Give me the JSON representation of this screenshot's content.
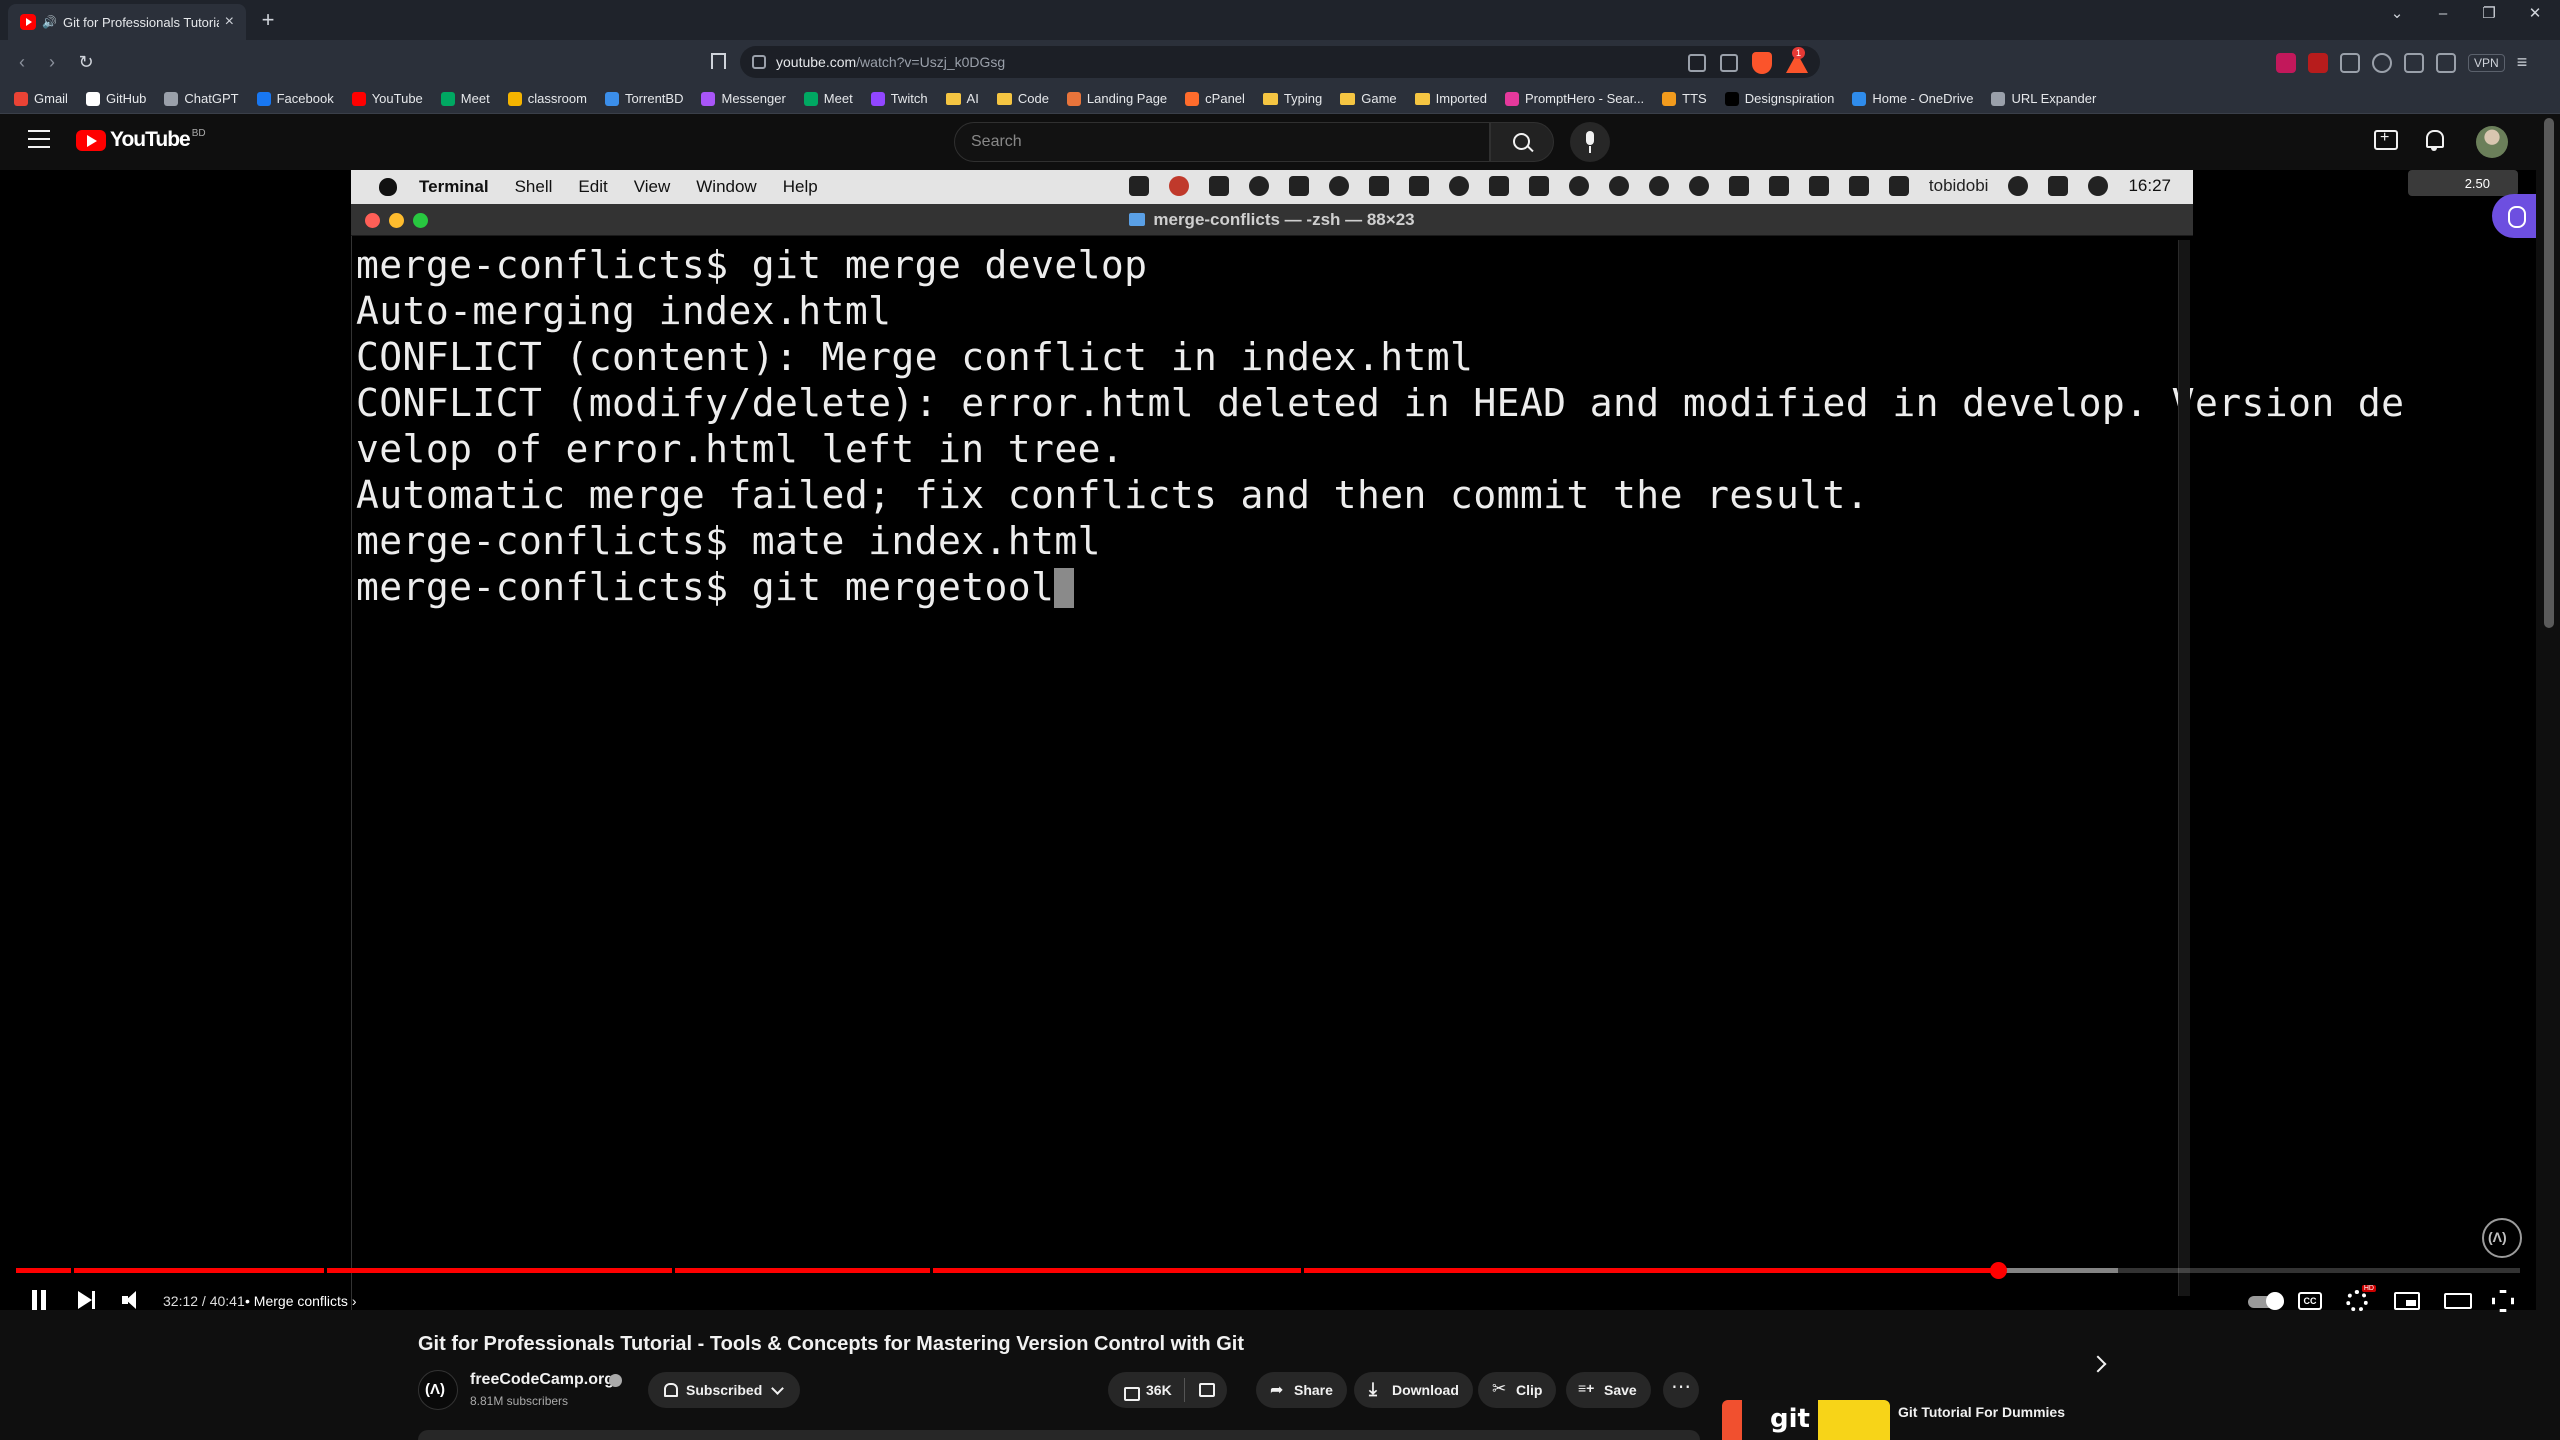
{
  "browser": {
    "tab_title": "Git for Professionals Tutorial",
    "new_tab": "+",
    "url_host": "youtube.com",
    "url_path": "/watch?v=Uszj_k0DGsg",
    "vpn_label": "VPN",
    "rewards_badge": "1",
    "bookmarks": [
      {
        "label": "Gmail",
        "icon": "gmail-icon",
        "color": "#ea4335"
      },
      {
        "label": "GitHub",
        "icon": "github-icon",
        "color": "#ffffff"
      },
      {
        "label": "ChatGPT",
        "icon": "chatgpt-icon",
        "color": "#9aa0aa"
      },
      {
        "label": "Facebook",
        "icon": "facebook-icon",
        "color": "#1877f2"
      },
      {
        "label": "YouTube",
        "icon": "youtube-icon",
        "color": "#ff0000"
      },
      {
        "label": "Meet",
        "icon": "meet-icon",
        "color": "#00a862"
      },
      {
        "label": "classroom",
        "icon": "classroom-icon",
        "color": "#f5b400"
      },
      {
        "label": "TorrentBD",
        "icon": "torrentbd-icon",
        "color": "#3b8eea"
      },
      {
        "label": "Messenger",
        "icon": "messenger-icon",
        "color": "#a855f7"
      },
      {
        "label": "Meet",
        "icon": "meet-icon",
        "color": "#00a862"
      },
      {
        "label": "Twitch",
        "icon": "twitch-icon",
        "color": "#9146ff"
      },
      {
        "label": "AI",
        "icon": "folder-icon",
        "color": "#f5c542"
      },
      {
        "label": "Code",
        "icon": "folder-icon",
        "color": "#f5c542"
      },
      {
        "label": "Landing Page",
        "icon": "landing-page-icon",
        "color": "#e8743b"
      },
      {
        "label": "cPanel",
        "icon": "cpanel-icon",
        "color": "#ff6c2c"
      },
      {
        "label": "Typing",
        "icon": "folder-icon",
        "color": "#f5c542"
      },
      {
        "label": "Game",
        "icon": "folder-icon",
        "color": "#f5c542"
      },
      {
        "label": "Imported",
        "icon": "folder-icon",
        "color": "#f5c542"
      },
      {
        "label": "PromptHero - Sear...",
        "icon": "prompthero-icon",
        "color": "#e5399c"
      },
      {
        "label": "TTS",
        "icon": "tts-icon",
        "color": "#f29b1d"
      },
      {
        "label": "Designspiration",
        "icon": "designspiration-icon",
        "color": "#000000"
      },
      {
        "label": "Home - OneDrive",
        "icon": "onedrive-icon",
        "color": "#2f8ceb"
      },
      {
        "label": "URL Expander",
        "icon": "url-expander-icon",
        "color": "#9aa0aa"
      }
    ]
  },
  "youtube": {
    "logo_text": "YouTube",
    "country_code": "BD",
    "search_placeholder": "Search"
  },
  "mac": {
    "menu": [
      "Terminal",
      "Shell",
      "Edit",
      "View",
      "Window",
      "Help"
    ],
    "user": "tobidobi",
    "clock": "16:27"
  },
  "terminal": {
    "window_title": "merge-conflicts — -zsh — 88×23",
    "lines": [
      "merge-conflicts$ git merge develop",
      "Auto-merging index.html",
      "CONFLICT (content): Merge conflict in index.html",
      "CONFLICT (modify/delete): error.html deleted in HEAD and modified in develop. Version de",
      "velop of error.html left in tree.",
      "Automatic merge failed; fix conflicts and then commit the result.",
      "merge-conflicts$ mate index.html",
      "merge-conflicts$ git mergetool"
    ]
  },
  "player": {
    "speed": "2.50",
    "current_time": "32:12",
    "duration": "40:41",
    "time_display": "32:12 / 40:41",
    "chapter": "• Merge conflicts",
    "played_fraction": 0.7914,
    "buffered_fraction": 0.8393,
    "chapter_marks": [
      0.022,
      0.123,
      0.262,
      0.365,
      0.513
    ]
  },
  "video": {
    "title": "Git for Professionals Tutorial - Tools & Concepts for Mastering Version Control with Git",
    "channel": "freeCodeCamp.org",
    "subscribers": "8.81M subscribers",
    "subscribed_label": "Subscribed",
    "likes": "36K",
    "share": "Share",
    "download": "Download",
    "clip": "Clip",
    "save": "Save",
    "more": "⋯"
  },
  "recommendation": {
    "thumb_text": "git",
    "title": "Git Tutorial For Dummies"
  },
  "colors": {
    "youtube_red": "#ff0000",
    "terminal_bg": "#000000",
    "terminal_text": "#ededed"
  }
}
